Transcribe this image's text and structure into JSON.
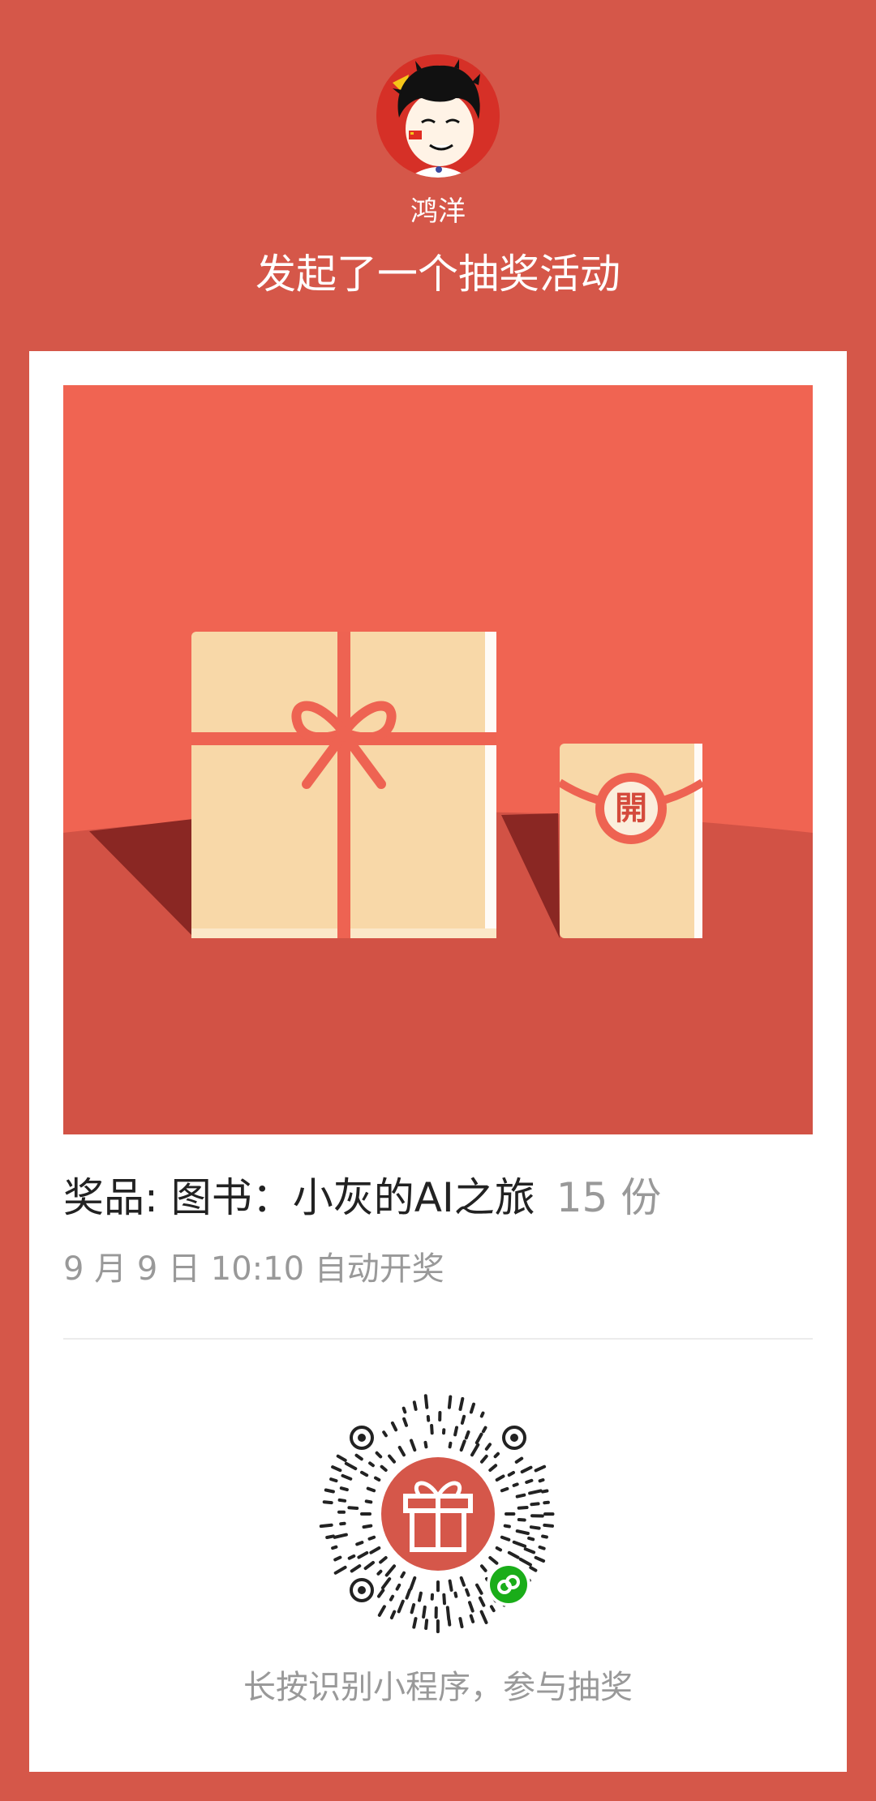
{
  "header": {
    "username": "鸿洋",
    "headline": "发起了一个抽奖活动"
  },
  "card": {
    "seal_char": "開",
    "prize_label": "奖品: 图书：小灰的AI之旅",
    "prize_count": "15 份",
    "draw_time": "9 月 9 日 10:10 自动开奖",
    "hint": "长按识别小程序，参与抽奖"
  },
  "colors": {
    "page_bg": "#D55749",
    "card_bg": "#FFFFFF",
    "illus_top": "#F06452",
    "illus_bottom": "#D25245",
    "box": "#F8D8A8",
    "ribbon": "#EE6352",
    "qr_center": "#D5574A",
    "miniprogram_badge": "#1AAD19"
  },
  "icons": {
    "avatar": "cartoon-avatar-icon",
    "gift": "gift-icon",
    "miniprogram": "miniprogram-link-icon"
  }
}
